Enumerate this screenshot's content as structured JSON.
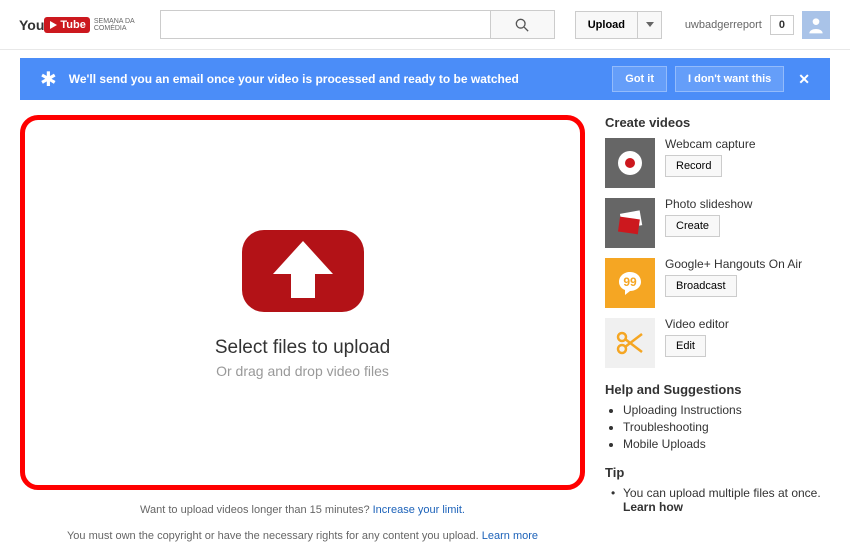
{
  "header": {
    "logo_main": "You",
    "logo_tube": "Tube",
    "logo_sub_line1": "SEMANA DA",
    "logo_sub_line2": "COMÉDIA",
    "search_placeholder": "",
    "upload_label": "Upload",
    "username": "uwbadgerreport",
    "badge_count": "0"
  },
  "notification": {
    "text": "We'll send you an email once your video is processed and ready to be watched",
    "got_it": "Got it",
    "dont_want": "I don't want this",
    "close": "✕"
  },
  "upload": {
    "title": "Select files to upload",
    "subtitle": "Or drag and drop video files",
    "hint_prefix": "Want to upload videos longer than 15 minutes? ",
    "hint_link": "Increase your limit.",
    "copyright_prefix": "You must own the copyright or have the necessary rights for any content you upload. ",
    "copyright_link": "Learn more"
  },
  "sidebar": {
    "create_title": "Create videos",
    "items": [
      {
        "label": "Webcam capture",
        "button": "Record"
      },
      {
        "label": "Photo slideshow",
        "button": "Create"
      },
      {
        "label": "Google+ Hangouts On Air",
        "button": "Broadcast"
      },
      {
        "label": "Video editor",
        "button": "Edit"
      }
    ],
    "help_title": "Help and Suggestions",
    "help_items": [
      "Uploading Instructions",
      "Troubleshooting",
      "Mobile Uploads"
    ],
    "tip_title": "Tip",
    "tip_text": "You can upload multiple files at once. ",
    "tip_link": "Learn how"
  }
}
